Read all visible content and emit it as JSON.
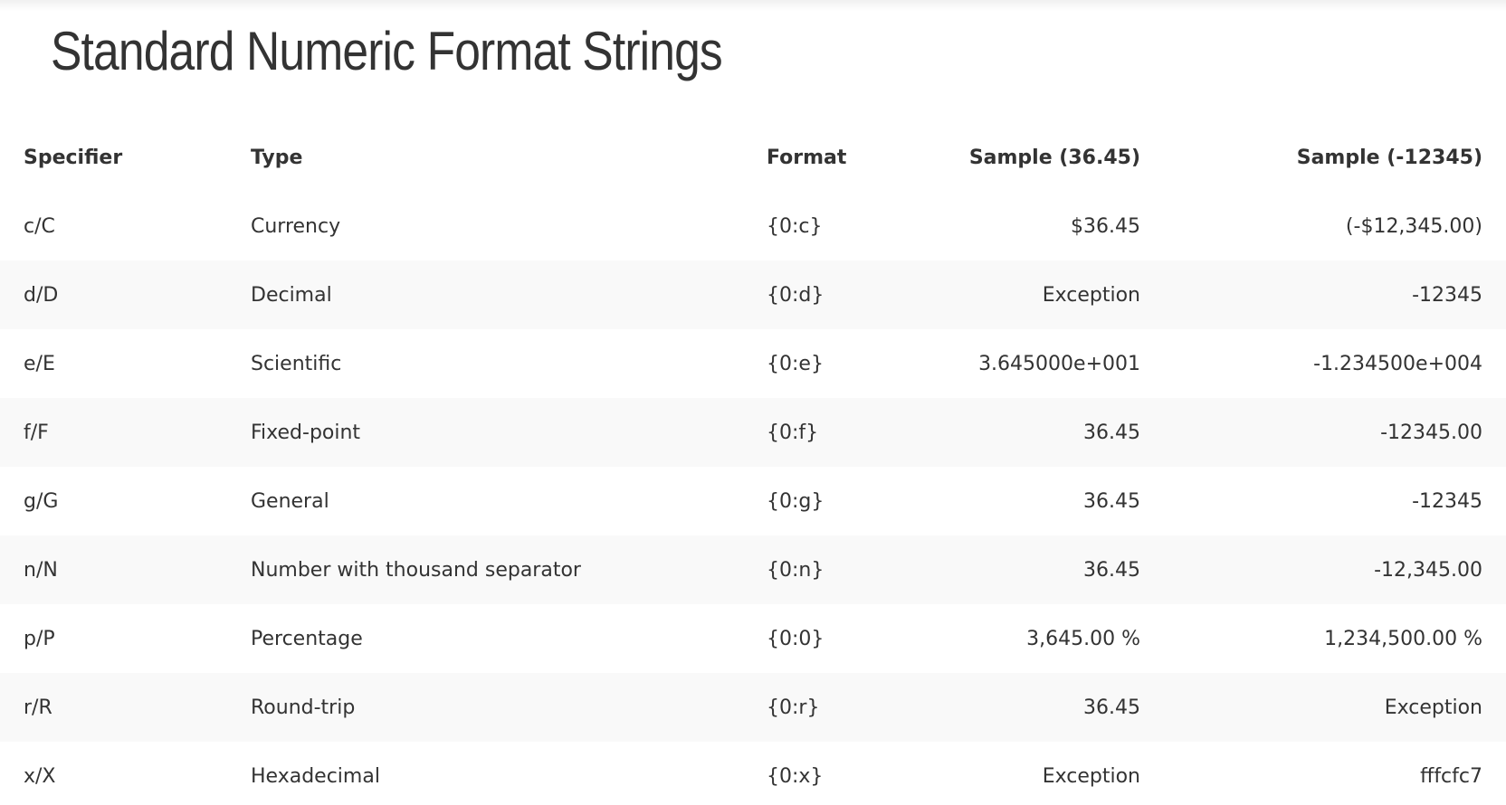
{
  "page": {
    "title": "Standard Numeric Format Strings"
  },
  "table": {
    "headers": {
      "specifier": "Specifier",
      "type": "Type",
      "format": "Format",
      "sample1": "Sample (36.45)",
      "sample2": "Sample (-12345)"
    },
    "rows": [
      {
        "specifier": "c/C",
        "type": "Currency",
        "format": "{0:c}",
        "sample1": "$36.45",
        "sample2": "(-$12,345.00)"
      },
      {
        "specifier": "d/D",
        "type": "Decimal",
        "format": "{0:d}",
        "sample1": "Exception",
        "sample2": "-12345"
      },
      {
        "specifier": "e/E",
        "type": "Scientific",
        "format": "{0:e}",
        "sample1": "3.645000e+001",
        "sample2": "-1.234500e+004"
      },
      {
        "specifier": "f/F",
        "type": "Fixed-point",
        "format": "{0:f}",
        "sample1": "36.45",
        "sample2": "-12345.00"
      },
      {
        "specifier": "g/G",
        "type": "General",
        "format": "{0:g}",
        "sample1": "36.45",
        "sample2": "-12345"
      },
      {
        "specifier": "n/N",
        "type": "Number with thousand separator",
        "format": "{0:n}",
        "sample1": "36.45",
        "sample2": "-12,345.00"
      },
      {
        "specifier": "p/P",
        "type": "Percentage",
        "format": "{0:0}",
        "sample1": "3,645.00 %",
        "sample2": "1,234,500.00 %"
      },
      {
        "specifier": "r/R",
        "type": "Round-trip",
        "format": "{0:r}",
        "sample1": "36.45",
        "sample2": "Exception"
      },
      {
        "specifier": "x/X",
        "type": "Hexadecimal",
        "format": "{0:x}",
        "sample1": "Exception",
        "sample2": "fffcfc7"
      }
    ]
  },
  "colors": {
    "text": "#333333",
    "row_stripe": "#f9f9f9",
    "background": "#ffffff"
  }
}
